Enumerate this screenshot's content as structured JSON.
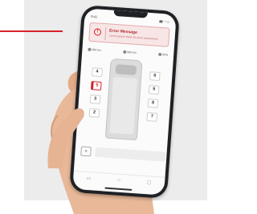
{
  "colors": {
    "accent": "#d6222a",
    "alert_bg": "#f8e6e6",
    "phone": "#1f2125"
  },
  "status_bar": {
    "time": "9:41",
    "icons": "▮▮ ◔ ▭"
  },
  "alert": {
    "icon": "exclamation-icon",
    "title": "Error Message",
    "text": "Lorem ipsum dolor sit amet consectetur"
  },
  "stats": [
    {
      "icon": "gauge-icon",
      "value": "000 km"
    },
    {
      "icon": "battery-icon",
      "value": "000 km"
    },
    {
      "icon": "fuel-icon",
      "value": "00%"
    }
  ],
  "seats_left": [
    "4",
    "5",
    "3",
    "2"
  ],
  "seats_right": [
    "6",
    "5",
    "8",
    "7"
  ],
  "active_seat": "5",
  "small_button": "≡",
  "action_button": "",
  "tabs": [
    "car-icon",
    "home-icon",
    "settings-icon"
  ]
}
